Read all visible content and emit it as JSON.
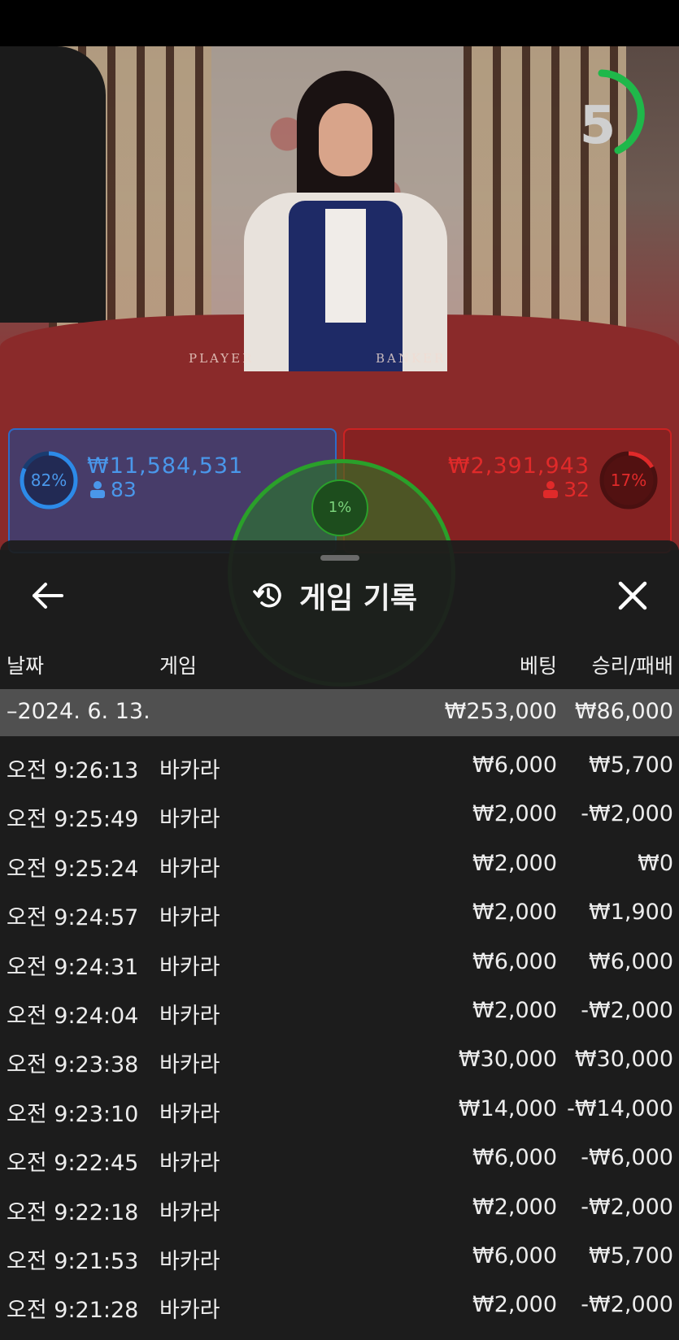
{
  "video": {
    "timer_value": "5",
    "table_labels": {
      "player": "PLAYER",
      "banker": "BANKER"
    }
  },
  "bets": {
    "player": {
      "percent": "82%",
      "amount": "₩11,584,531",
      "players": "83"
    },
    "banker": {
      "percent": "17%",
      "amount": "₩2,391,943",
      "players": "32"
    },
    "tie": {
      "percent": "1%"
    }
  },
  "history": {
    "title": "게임 기록",
    "columns": {
      "date": "날짜",
      "game": "게임",
      "bet": "베팅",
      "win_loss": "승리/패배"
    },
    "summary": {
      "date": "–2024. 6. 13.",
      "bet": "₩253,000",
      "win_loss": "₩86,000"
    },
    "rows": [
      {
        "time": "오전 9:26:13",
        "game": "바카라",
        "bet": "₩6,000",
        "win_loss": "₩5,700"
      },
      {
        "time": "오전 9:25:49",
        "game": "바카라",
        "bet": "₩2,000",
        "win_loss": "-₩2,000"
      },
      {
        "time": "오전 9:25:24",
        "game": "바카라",
        "bet": "₩2,000",
        "win_loss": "₩0"
      },
      {
        "time": "오전 9:24:57",
        "game": "바카라",
        "bet": "₩2,000",
        "win_loss": "₩1,900"
      },
      {
        "time": "오전 9:24:31",
        "game": "바카라",
        "bet": "₩6,000",
        "win_loss": "₩6,000"
      },
      {
        "time": "오전 9:24:04",
        "game": "바카라",
        "bet": "₩2,000",
        "win_loss": "-₩2,000"
      },
      {
        "time": "오전 9:23:38",
        "game": "바카라",
        "bet": "₩30,000",
        "win_loss": "₩30,000"
      },
      {
        "time": "오전 9:23:10",
        "game": "바카라",
        "bet": "₩14,000",
        "win_loss": "-₩14,000"
      },
      {
        "time": "오전 9:22:45",
        "game": "바카라",
        "bet": "₩6,000",
        "win_loss": "-₩6,000"
      },
      {
        "time": "오전 9:22:18",
        "game": "바카라",
        "bet": "₩2,000",
        "win_loss": "-₩2,000"
      },
      {
        "time": "오전 9:21:53",
        "game": "바카라",
        "bet": "₩6,000",
        "win_loss": "₩5,700"
      },
      {
        "time": "오전 9:21:28",
        "game": "바카라",
        "bet": "₩2,000",
        "win_loss": "-₩2,000"
      }
    ]
  },
  "icons": {
    "back": "arrow-left-icon",
    "history": "history-clock-icon",
    "close": "close-icon",
    "person": "person-icon"
  },
  "colors": {
    "player": "#2d6cc8",
    "banker": "#cc2222",
    "tie": "#2aa02a",
    "timer": "#1fb84a"
  }
}
